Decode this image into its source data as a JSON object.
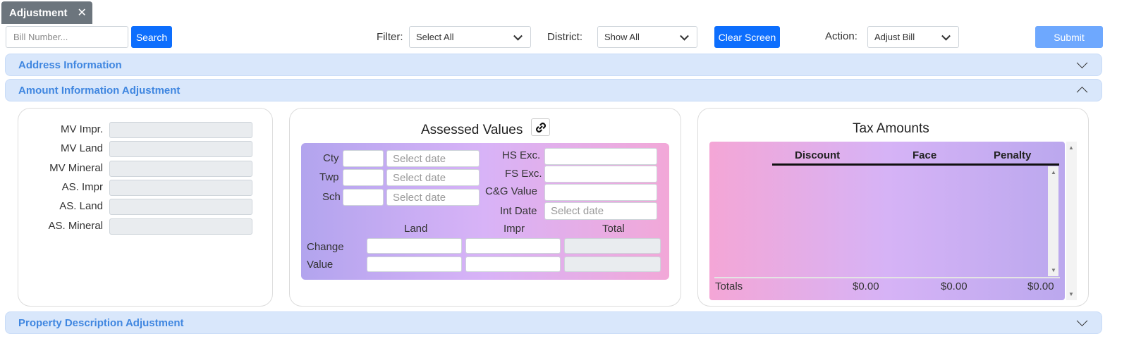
{
  "tab": {
    "label": "Adjustment",
    "close": "✕"
  },
  "toolbar": {
    "bill_placeholder": "Bill Number...",
    "search_label": "Search",
    "filter_label": "Filter:",
    "filter_value": "Select All",
    "district_label": "District:",
    "district_value": "Show All",
    "clear_label": "Clear Screen",
    "action_label": "Action:",
    "action_value": "Adjust Bill",
    "submit_label": "Submit"
  },
  "sections": {
    "address": "Address Information",
    "amount": "Amount Information Adjustment",
    "property": "Property Description Adjustment"
  },
  "market_values": {
    "labels": [
      "MV Impr.",
      "MV Land",
      "MV Mineral",
      "AS. Impr",
      "AS. Land",
      "AS. Mineral"
    ]
  },
  "assessed": {
    "title": "Assessed Values",
    "left_labels": [
      "Cty",
      "Twp",
      "Sch"
    ],
    "date_placeholder": "Select date",
    "right_labels": [
      "HS Exc.",
      "FS Exc.",
      "C&G Value",
      "Int Date"
    ],
    "col_headers": [
      "Land",
      "Impr",
      "Total"
    ],
    "row_labels": [
      "Change",
      "Value"
    ]
  },
  "tax": {
    "title": "Tax Amounts",
    "headers": [
      "Discount",
      "Face",
      "Penalty"
    ],
    "totals_label": "Totals",
    "totals": [
      "$0.00",
      "$0.00",
      "$0.00"
    ]
  },
  "colors": {
    "primary": "#0d6efd",
    "accordion_bg": "#d9e7fb",
    "accordion_text": "#3f86e0",
    "tab_bg": "#6c757d"
  },
  "icons": {
    "link": "link-icon",
    "close": "close-icon",
    "chevron": "chevron-icon"
  }
}
